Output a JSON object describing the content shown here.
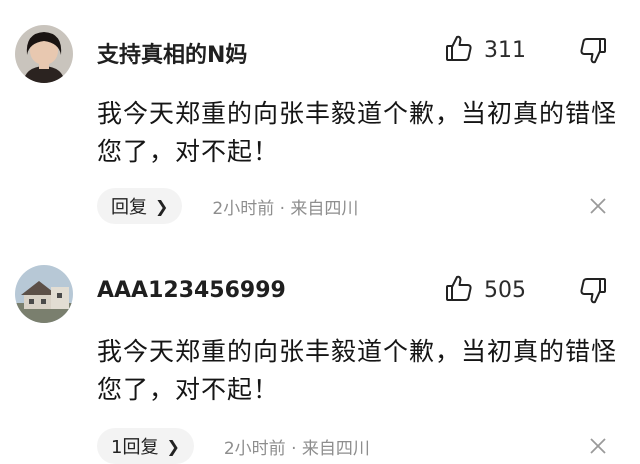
{
  "comments": [
    {
      "username": "支持真相的N妈",
      "avatar_icon": "user-photo-avatar",
      "like_count": "311",
      "content": "我今天郑重的向张丰毅道个歉，当初真的错怪您了，对不起！",
      "reply_label": "回复",
      "time_location": "2小时前 · 来自四川"
    },
    {
      "username": "AAA123456999",
      "avatar_icon": "house-photo-avatar",
      "like_count": "505",
      "content": "我今天郑重的向张丰毅道个歉，当初真的错怪您了，对不起！",
      "reply_label": "1回复",
      "time_location": "2小时前 · 来自四川"
    }
  ],
  "icons": {
    "like": "thumbs-up-icon",
    "dislike": "thumbs-down-icon",
    "close": "close-icon",
    "chevron": "chevron-right-icon"
  },
  "colors": {
    "background": "#ffffff",
    "reply_bg": "#f3f3f3",
    "meta_text": "#8e8e8e"
  }
}
